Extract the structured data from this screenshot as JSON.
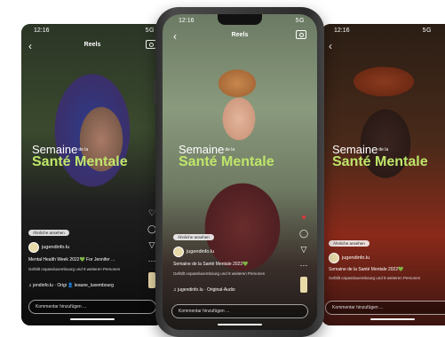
{
  "status": {
    "time": "12:16",
    "signal": "5G"
  },
  "header": {
    "title": "Reels"
  },
  "overlay": {
    "line1": "Semaine",
    "line1_small": "de la",
    "line2": "Santé Mentale"
  },
  "similar_pill": "Ähnliche ansehen",
  "username": "jugendinfo.lu",
  "left": {
    "caption": "Mental Health Week 2022💚 For Jennifer ...",
    "collab": "Gefällt cepassluxembourg und 9 weiteren Personen",
    "music": "♫  jendinfo.lu · Origi   👤 leaune_luxembourg"
  },
  "center": {
    "caption": "Semaine de la Santé Mentale 2022💚",
    "collab": "Gefällt cepassluxembourg und 9 weiteren Personen",
    "music": "♫  jugendinfo.lu · Original-Audio"
  },
  "right": {
    "caption": "Semaine de la Santé Mentale 2022💚",
    "collab": "Gefällt cepassluxembourg und 9 weiteren Personen",
    "music": ""
  },
  "comment_placeholder": "Kommentar hinzufügen ..."
}
